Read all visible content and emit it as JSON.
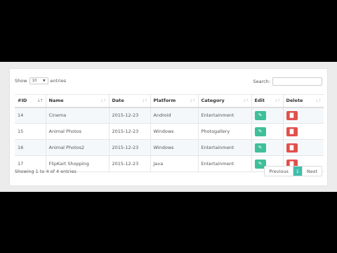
{
  "length_control": {
    "prefix": "Show",
    "selected": "10",
    "suffix": "entries"
  },
  "search": {
    "label": "Search:",
    "value": ""
  },
  "table": {
    "headers": [
      "#ID",
      "Name",
      "Date",
      "Platform",
      "Category",
      "Edit",
      "Delete"
    ],
    "rows": [
      [
        "14",
        "Cinema",
        "2015-12-23",
        "Android",
        "Entertainment"
      ],
      [
        "15",
        "Animal Photos",
        "2015-12-23",
        "Windows",
        "Photogallery"
      ],
      [
        "16",
        "Animal Photos2",
        "2015-12-23",
        "Windows",
        "Entertainment"
      ],
      [
        "17",
        "FlipKart Shopping",
        "2015-12-23",
        "Java",
        "Entertainment"
      ]
    ],
    "edit_icon": "pencil-icon",
    "delete_icon": "trash-icon"
  },
  "info": "Showing 1 to 4 of 4 entries",
  "pagination": {
    "previous": "Previous",
    "current": "1",
    "next": "Next"
  },
  "colors": {
    "edit_button": "#3fbf9a",
    "delete_button": "#e2504c",
    "current_page": "#3fbfaa"
  }
}
